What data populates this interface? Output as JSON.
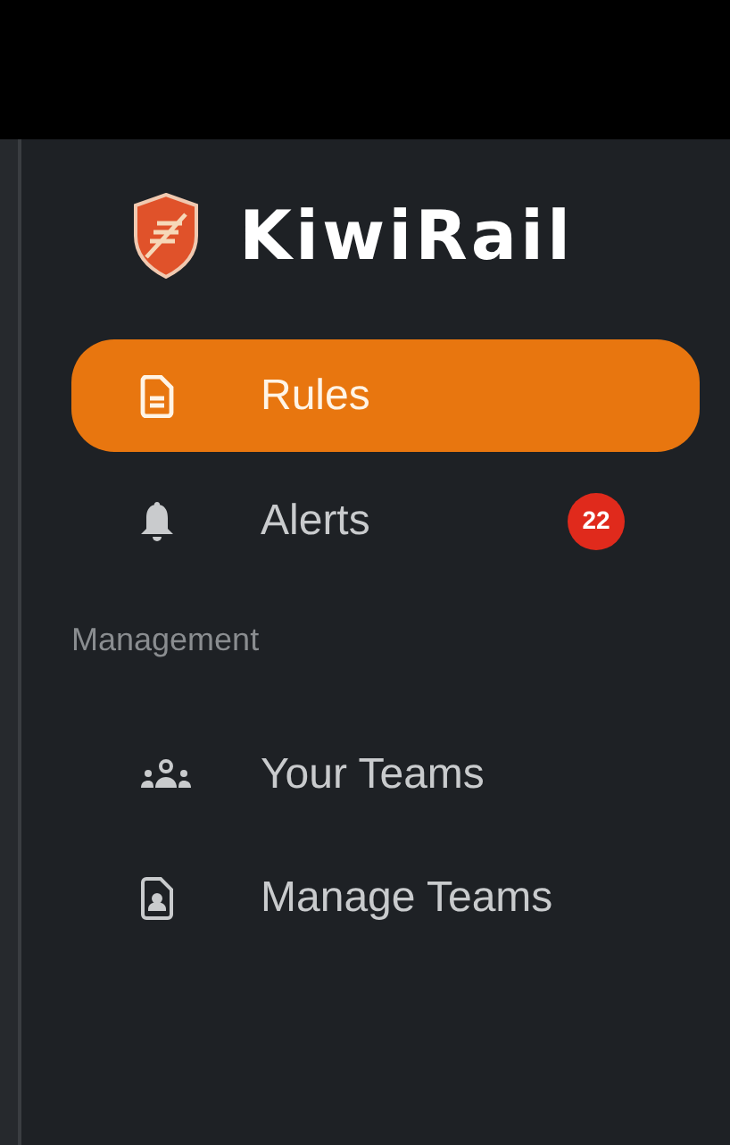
{
  "brand": {
    "name": "KiwiRail"
  },
  "nav_items": [
    {
      "label": "Rules",
      "selected": true
    },
    {
      "label": "Alerts",
      "selected": false,
      "badge": "22"
    }
  ],
  "sections": [
    {
      "title": "Management",
      "items": [
        {
          "label": "Your Teams",
          "selected": false
        },
        {
          "label": "Manage Teams",
          "selected": false
        }
      ]
    }
  ]
}
